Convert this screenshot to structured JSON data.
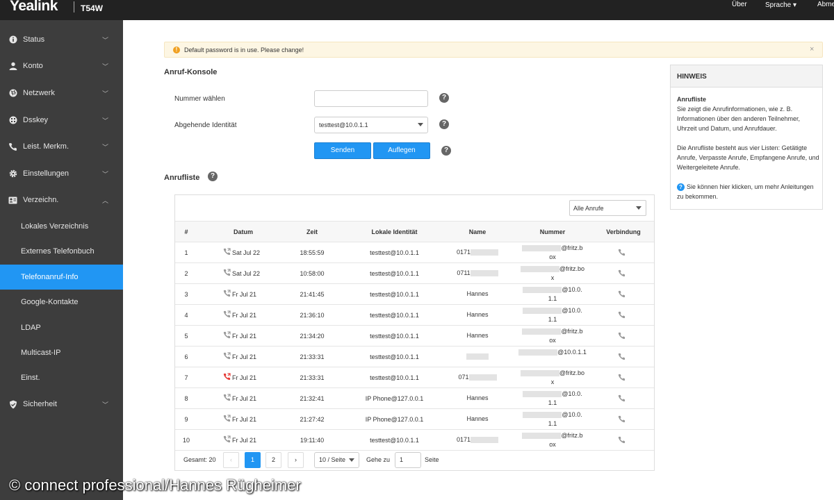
{
  "topbar": {
    "brand": "Yealink",
    "model": "T54W",
    "nav": {
      "about": "Über",
      "language": "Sprache ▾",
      "logout": "Abme"
    }
  },
  "sidebar": {
    "items": [
      {
        "label": "Status",
        "icon": "info-icon"
      },
      {
        "label": "Konto",
        "icon": "user-icon"
      },
      {
        "label": "Netzwerk",
        "icon": "globe-icon"
      },
      {
        "label": "Dsskey",
        "icon": "keypad-icon"
      },
      {
        "label": "Leist. Merkm.",
        "icon": "phone-icon"
      },
      {
        "label": "Einstellungen",
        "icon": "gear-icon"
      },
      {
        "label": "Verzeichn.",
        "icon": "contact-card-icon"
      }
    ],
    "subitems": [
      {
        "label": "Lokales Verzeichnis"
      },
      {
        "label": "Externes Telefonbuch"
      },
      {
        "label": "Telefonanruf-Info"
      },
      {
        "label": "Google-Kontakte"
      },
      {
        "label": "LDAP"
      },
      {
        "label": "Multicast-IP"
      },
      {
        "label": "Einst."
      }
    ],
    "security": {
      "label": "Sicherheit",
      "icon": "shield-icon"
    }
  },
  "alert": {
    "message": "Default password is in use. Please change!",
    "close": "×"
  },
  "console": {
    "title": "Anruf-Konsole",
    "dial_label": "Nummer wählen",
    "dial_value": "",
    "identity_label": "Abgehende Identität",
    "identity_value": "testtest@10.0.1.1",
    "send": "Senden",
    "hangup": "Auflegen",
    "help": "?"
  },
  "calllist": {
    "title": "Anrufliste",
    "filter": "Alle Anrufe",
    "headers": [
      "#",
      "Datum",
      "Zeit",
      "Lokale Identität",
      "Name",
      "Nummer",
      "Verbindung"
    ],
    "rows": [
      {
        "n": "1",
        "date": "Sat Jul 22",
        "time": "18:55:59",
        "identity": "testtest@10.0.1.1",
        "name": "0171",
        "number": "@fritz.b",
        "number2": "ox",
        "type": "outgoing"
      },
      {
        "n": "2",
        "date": "Sat Jul 22",
        "time": "10:58:00",
        "identity": "testtest@10.0.1.1",
        "name": "0711",
        "number": "@fritz.bo",
        "number2": "x",
        "type": "outgoing"
      },
      {
        "n": "3",
        "date": "Fr Jul 21",
        "time": "21:41:45",
        "identity": "testtest@10.0.1.1",
        "name": "Hannes",
        "number": "@10.0.",
        "number2": "1.1",
        "type": "outgoing"
      },
      {
        "n": "4",
        "date": "Fr Jul 21",
        "time": "21:36:10",
        "identity": "testtest@10.0.1.1",
        "name": "Hannes",
        "number": "@10.0.",
        "number2": "1.1",
        "type": "outgoing"
      },
      {
        "n": "5",
        "date": "Fr Jul 21",
        "time": "21:34:20",
        "identity": "testtest@10.0.1.1",
        "name": "Hannes",
        "number": "@fritz.b",
        "number2": "ox",
        "type": "outgoing"
      },
      {
        "n": "6",
        "date": "Fr Jul 21",
        "time": "21:33:31",
        "identity": "testtest@10.0.1.1",
        "name": "",
        "number": "@10.0.1.1",
        "number2": "",
        "type": "outgoing"
      },
      {
        "n": "7",
        "date": "Fr Jul 21",
        "time": "21:33:31",
        "identity": "testtest@10.0.1.1",
        "name": "071",
        "number": "@fritz.bo",
        "number2": "x",
        "type": "missed"
      },
      {
        "n": "8",
        "date": "Fr Jul 21",
        "time": "21:32:41",
        "identity": "IP Phone@127.0.0.1",
        "name": "Hannes",
        "number": "@10.0.",
        "number2": "1.1",
        "type": "outgoing"
      },
      {
        "n": "9",
        "date": "Fr Jul 21",
        "time": "21:27:42",
        "identity": "IP Phone@127.0.0.1",
        "name": "Hannes",
        "number": "@10.0.",
        "number2": "1.1",
        "type": "outgoing"
      },
      {
        "n": "10",
        "date": "Fr Jul 21",
        "time": "19:11:40",
        "identity": "testtest@10.0.1.1",
        "name": "0171",
        "number": "@fritz.b",
        "number2": "ox",
        "type": "outgoing"
      }
    ],
    "pager": {
      "total": "Gesamt: 20",
      "prev": "‹",
      "pages": [
        "1",
        "2"
      ],
      "next": "›",
      "per_page": "10 / Seite",
      "goto_label": "Gehe zu",
      "goto_value": "1",
      "page_label": "Seite"
    }
  },
  "hint": {
    "title": "HINWEIS",
    "heading": "Anrufliste",
    "text1": "Sie zeigt die Anrufinformationen, wie z. B. Informationen über den anderen Teilnehmer, Uhrzeit und Datum, und Anrufdauer.",
    "text2": "Die Anrufliste besteht aus vier Listen: Getätigte Anrufe, Verpasste Anrufe, Empfangene Anrufe, und Weitergeleitete Anrufe.",
    "text3": "Sie können hier klicken, um mehr Anleitungen zu bekommen."
  },
  "watermark": "© connect professional/Hannes Rügheimer",
  "colors": {
    "accent": "#2196f3",
    "sidebar": "#3d3d3d",
    "topbar": "#222222",
    "missed": "#e53935"
  }
}
